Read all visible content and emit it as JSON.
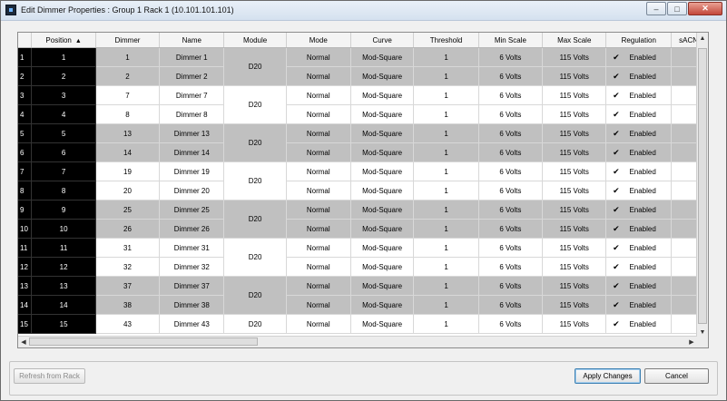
{
  "window": {
    "title": "Edit Dimmer Properties : Group 1 Rack 1 (10.101.101.101)"
  },
  "icons": [
    "app-icon",
    "minimize-icon",
    "maximize-icon",
    "close-icon",
    "sort-asc-icon",
    "checkbox-checked-icon"
  ],
  "grid": {
    "columns": [
      "Position",
      "Dimmer",
      "Name",
      "Module",
      "Mode",
      "Curve",
      "Threshold",
      "Min Scale",
      "Max Scale",
      "Regulation",
      "sACN"
    ],
    "sort": {
      "column": "Position",
      "direction": "ascending"
    },
    "rows": [
      {
        "row": "1",
        "position": "1",
        "dimmer": "1",
        "name": "Dimmer 1",
        "module": "D20",
        "mode": "Normal",
        "curve": "Mod-Square",
        "threshold": "1",
        "min": "6 Volts",
        "max": "115 Volts",
        "regulation": "Enabled",
        "checked": true,
        "shade": "gray",
        "moduleStart": true
      },
      {
        "row": "2",
        "position": "2",
        "dimmer": "2",
        "name": "Dimmer 2",
        "module": "",
        "mode": "Normal",
        "curve": "Mod-Square",
        "threshold": "1",
        "min": "6 Volts",
        "max": "115 Volts",
        "regulation": "Enabled",
        "checked": true,
        "shade": "gray",
        "moduleStart": false
      },
      {
        "row": "3",
        "position": "3",
        "dimmer": "7",
        "name": "Dimmer 7",
        "module": "D20",
        "mode": "Normal",
        "curve": "Mod-Square",
        "threshold": "1",
        "min": "6 Volts",
        "max": "115 Volts",
        "regulation": "Enabled",
        "checked": true,
        "shade": "white",
        "moduleStart": true
      },
      {
        "row": "4",
        "position": "4",
        "dimmer": "8",
        "name": "Dimmer 8",
        "module": "",
        "mode": "Normal",
        "curve": "Mod-Square",
        "threshold": "1",
        "min": "6 Volts",
        "max": "115 Volts",
        "regulation": "Enabled",
        "checked": true,
        "shade": "white",
        "moduleStart": false
      },
      {
        "row": "5",
        "position": "5",
        "dimmer": "13",
        "name": "Dimmer 13",
        "module": "D20",
        "mode": "Normal",
        "curve": "Mod-Square",
        "threshold": "1",
        "min": "6 Volts",
        "max": "115 Volts",
        "regulation": "Enabled",
        "checked": true,
        "shade": "gray",
        "moduleStart": true
      },
      {
        "row": "6",
        "position": "6",
        "dimmer": "14",
        "name": "Dimmer 14",
        "module": "",
        "mode": "Normal",
        "curve": "Mod-Square",
        "threshold": "1",
        "min": "6 Volts",
        "max": "115 Volts",
        "regulation": "Enabled",
        "checked": true,
        "shade": "gray",
        "moduleStart": false
      },
      {
        "row": "7",
        "position": "7",
        "dimmer": "19",
        "name": "Dimmer 19",
        "module": "D20",
        "mode": "Normal",
        "curve": "Mod-Square",
        "threshold": "1",
        "min": "6 Volts",
        "max": "115 Volts",
        "regulation": "Enabled",
        "checked": true,
        "shade": "white",
        "moduleStart": true
      },
      {
        "row": "8",
        "position": "8",
        "dimmer": "20",
        "name": "Dimmer 20",
        "module": "",
        "mode": "Normal",
        "curve": "Mod-Square",
        "threshold": "1",
        "min": "6 Volts",
        "max": "115 Volts",
        "regulation": "Enabled",
        "checked": true,
        "shade": "white",
        "moduleStart": false
      },
      {
        "row": "9",
        "position": "9",
        "dimmer": "25",
        "name": "Dimmer 25",
        "module": "D20",
        "mode": "Normal",
        "curve": "Mod-Square",
        "threshold": "1",
        "min": "6 Volts",
        "max": "115 Volts",
        "regulation": "Enabled",
        "checked": true,
        "shade": "gray",
        "moduleStart": true
      },
      {
        "row": "10",
        "position": "10",
        "dimmer": "26",
        "name": "Dimmer 26",
        "module": "",
        "mode": "Normal",
        "curve": "Mod-Square",
        "threshold": "1",
        "min": "6 Volts",
        "max": "115 Volts",
        "regulation": "Enabled",
        "checked": true,
        "shade": "gray",
        "moduleStart": false
      },
      {
        "row": "11",
        "position": "11",
        "dimmer": "31",
        "name": "Dimmer 31",
        "module": "D20",
        "mode": "Normal",
        "curve": "Mod-Square",
        "threshold": "1",
        "min": "6 Volts",
        "max": "115 Volts",
        "regulation": "Enabled",
        "checked": true,
        "shade": "white",
        "moduleStart": true
      },
      {
        "row": "12",
        "position": "12",
        "dimmer": "32",
        "name": "Dimmer 32",
        "module": "",
        "mode": "Normal",
        "curve": "Mod-Square",
        "threshold": "1",
        "min": "6 Volts",
        "max": "115 Volts",
        "regulation": "Enabled",
        "checked": true,
        "shade": "white",
        "moduleStart": false
      },
      {
        "row": "13",
        "position": "13",
        "dimmer": "37",
        "name": "Dimmer 37",
        "module": "D20",
        "mode": "Normal",
        "curve": "Mod-Square",
        "threshold": "1",
        "min": "6 Volts",
        "max": "115 Volts",
        "regulation": "Enabled",
        "checked": true,
        "shade": "gray",
        "moduleStart": true
      },
      {
        "row": "14",
        "position": "14",
        "dimmer": "38",
        "name": "Dimmer 38",
        "module": "",
        "mode": "Normal",
        "curve": "Mod-Square",
        "threshold": "1",
        "min": "6 Volts",
        "max": "115 Volts",
        "regulation": "Enabled",
        "checked": true,
        "shade": "gray",
        "moduleStart": false
      },
      {
        "row": "15",
        "position": "15",
        "dimmer": "43",
        "name": "Dimmer 43",
        "module": "D20",
        "mode": "Normal",
        "curve": "Mod-Square",
        "threshold": "1",
        "min": "6 Volts",
        "max": "115 Volts",
        "regulation": "Enabled",
        "checked": true,
        "shade": "white",
        "moduleStart": true
      }
    ]
  },
  "buttons": {
    "refresh": "Refresh from Rack",
    "apply": "Apply Changes",
    "cancel": "Cancel"
  }
}
